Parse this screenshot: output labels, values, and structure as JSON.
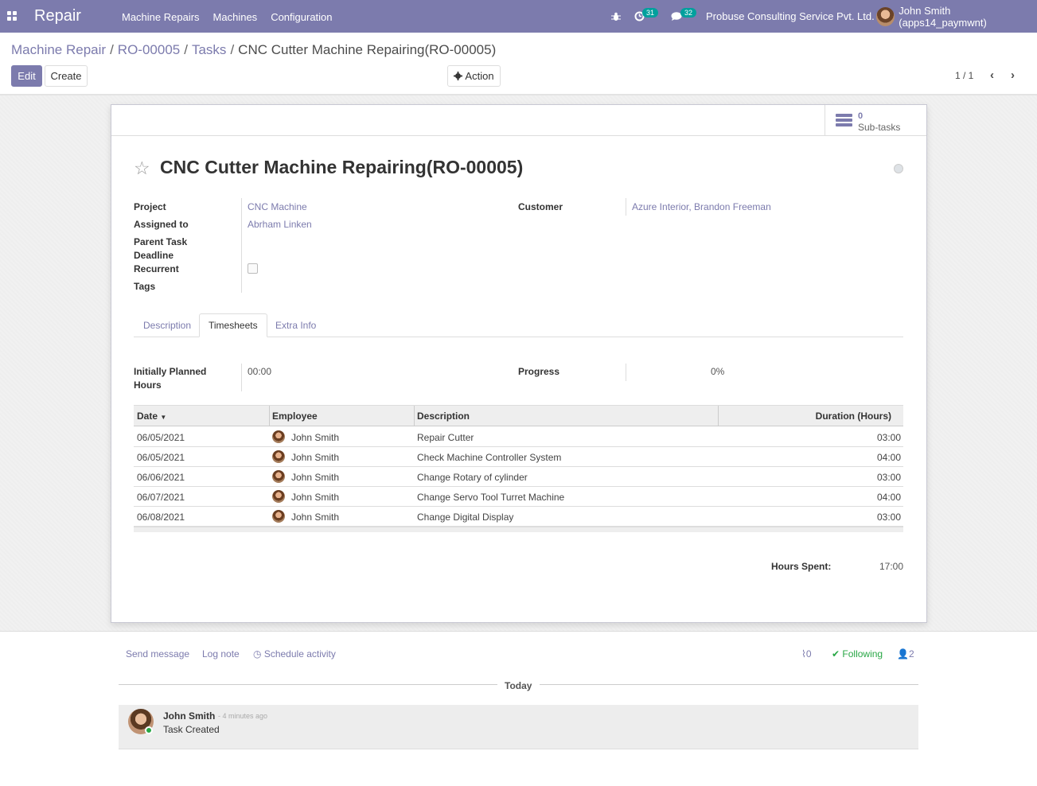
{
  "navbar": {
    "brand": "Repair",
    "menu": [
      "Machine Repairs",
      "Machines",
      "Configuration"
    ],
    "activity_count": "31",
    "message_count": "32",
    "company": "Probuse Consulting Service Pvt. Ltd.",
    "user": "John Smith (apps14_paymwnt)"
  },
  "breadcrumb": {
    "items": [
      "Machine Repair",
      "RO-00005",
      "Tasks"
    ],
    "current": "CNC Cutter Machine Repairing(RO-00005)"
  },
  "controls": {
    "edit": "Edit",
    "create": "Create",
    "action": "Action",
    "pager": "1 / 1"
  },
  "stat": {
    "value": "0",
    "label": "Sub-tasks"
  },
  "record": {
    "title": "CNC Cutter Machine Repairing(RO-00005)",
    "labels": {
      "project": "Project",
      "assigned": "Assigned to",
      "parent": "Parent Task",
      "deadline": "Deadline",
      "recurrent": "Recurrent",
      "tags": "Tags",
      "customer": "Customer"
    },
    "project": "CNC Machine",
    "assigned": "Abrham Linken",
    "customer": "Azure Interior, Brandon Freeman",
    "recurrent_checked": false
  },
  "tabs": [
    "Description",
    "Timesheets",
    "Extra Info"
  ],
  "timesheet": {
    "planned_label_1": "Initially Planned",
    "planned_label_2": "Hours",
    "planned_value": "00:00",
    "progress_label": "Progress",
    "progress_value": "0%",
    "columns": [
      "Date",
      "Employee",
      "Description",
      "Duration (Hours)"
    ],
    "rows": [
      {
        "date": "06/05/2021",
        "employee": "John Smith",
        "description": "Repair Cutter",
        "duration": "03:00"
      },
      {
        "date": "06/05/2021",
        "employee": "John Smith",
        "description": "Check Machine Controller System",
        "duration": "04:00"
      },
      {
        "date": "06/06/2021",
        "employee": "John Smith",
        "description": "Change Rotary of cylinder",
        "duration": "03:00"
      },
      {
        "date": "06/07/2021",
        "employee": "John Smith",
        "description": "Change Servo Tool Turret Machine",
        "duration": "04:00"
      },
      {
        "date": "06/08/2021",
        "employee": "John Smith",
        "description": "Change Digital Display",
        "duration": "03:00"
      }
    ],
    "hours_spent_label": "Hours Spent:",
    "hours_spent_value": "17:00"
  },
  "chatter": {
    "send": "Send message",
    "log": "Log note",
    "schedule": "Schedule activity",
    "attachments": "0",
    "following": "Following",
    "followers": "2",
    "today": "Today",
    "message": {
      "author": "John Smith",
      "time": "- 4 minutes ago",
      "body": "Task Created"
    }
  },
  "colors": {
    "brand": "#7c7bad",
    "badge": "#00a09d",
    "following": "#28a745"
  }
}
